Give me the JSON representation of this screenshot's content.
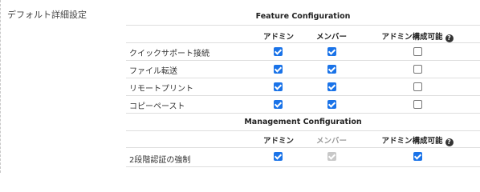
{
  "left_title": "デフォルト詳細設定",
  "feature": {
    "title": "Feature Configuration",
    "columns": [
      "アドミン",
      "メンバー",
      "アドミン構成可能"
    ],
    "rows": [
      {
        "label": "クイックサポート接続",
        "admin": true,
        "member": true,
        "configurable": false
      },
      {
        "label": "ファイル転送",
        "admin": true,
        "member": true,
        "configurable": false
      },
      {
        "label": "リモートプリント",
        "admin": true,
        "member": true,
        "configurable": false
      },
      {
        "label": "コピーペースト",
        "admin": true,
        "member": true,
        "configurable": false
      }
    ]
  },
  "management": {
    "title": "Management Configuration",
    "columns": [
      "アドミン",
      "メンバー",
      "アドミン構成可能"
    ],
    "rows": [
      {
        "label": "2段階認証の強制",
        "admin": true,
        "member": "disabled",
        "configurable": true
      }
    ]
  },
  "icons": {
    "help": "help-circle-icon"
  },
  "colors": {
    "checked": "#1a73e8",
    "disabled": "#c8c8c8"
  }
}
